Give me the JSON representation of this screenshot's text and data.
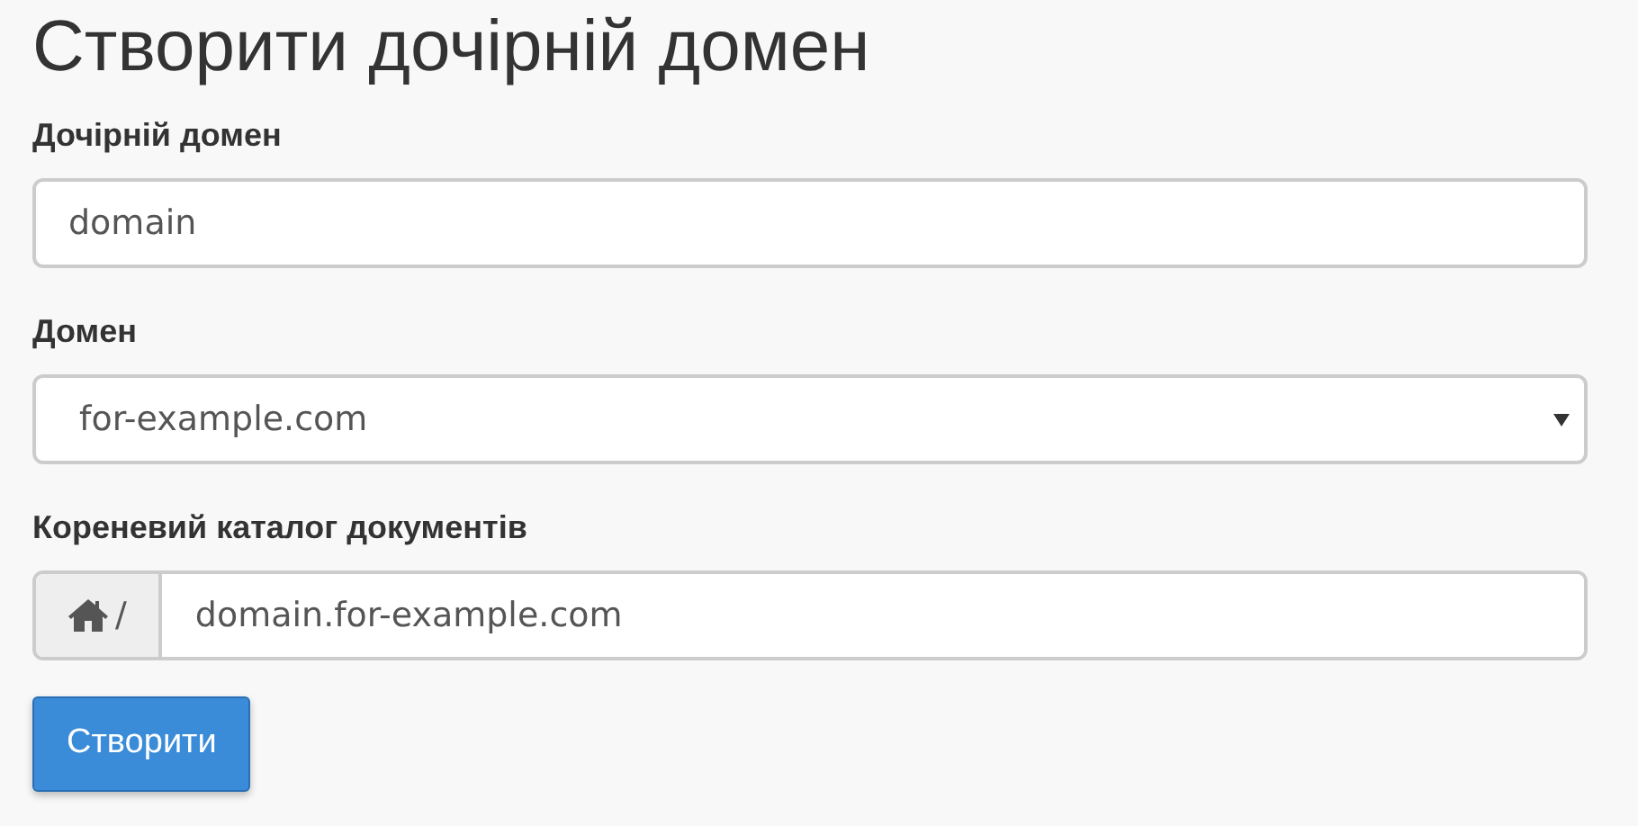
{
  "title": "Створити дочірній домен",
  "fields": [
    {
      "kind": "text",
      "label": "Дочірній домен",
      "value": "domain"
    },
    {
      "kind": "select",
      "label": "Домен",
      "value": "for-example.com"
    },
    {
      "kind": "prefixed",
      "label": "Кореневий каталог документів",
      "prefix": "/",
      "value": "domain.for-example.com"
    }
  ],
  "button": "Створити"
}
